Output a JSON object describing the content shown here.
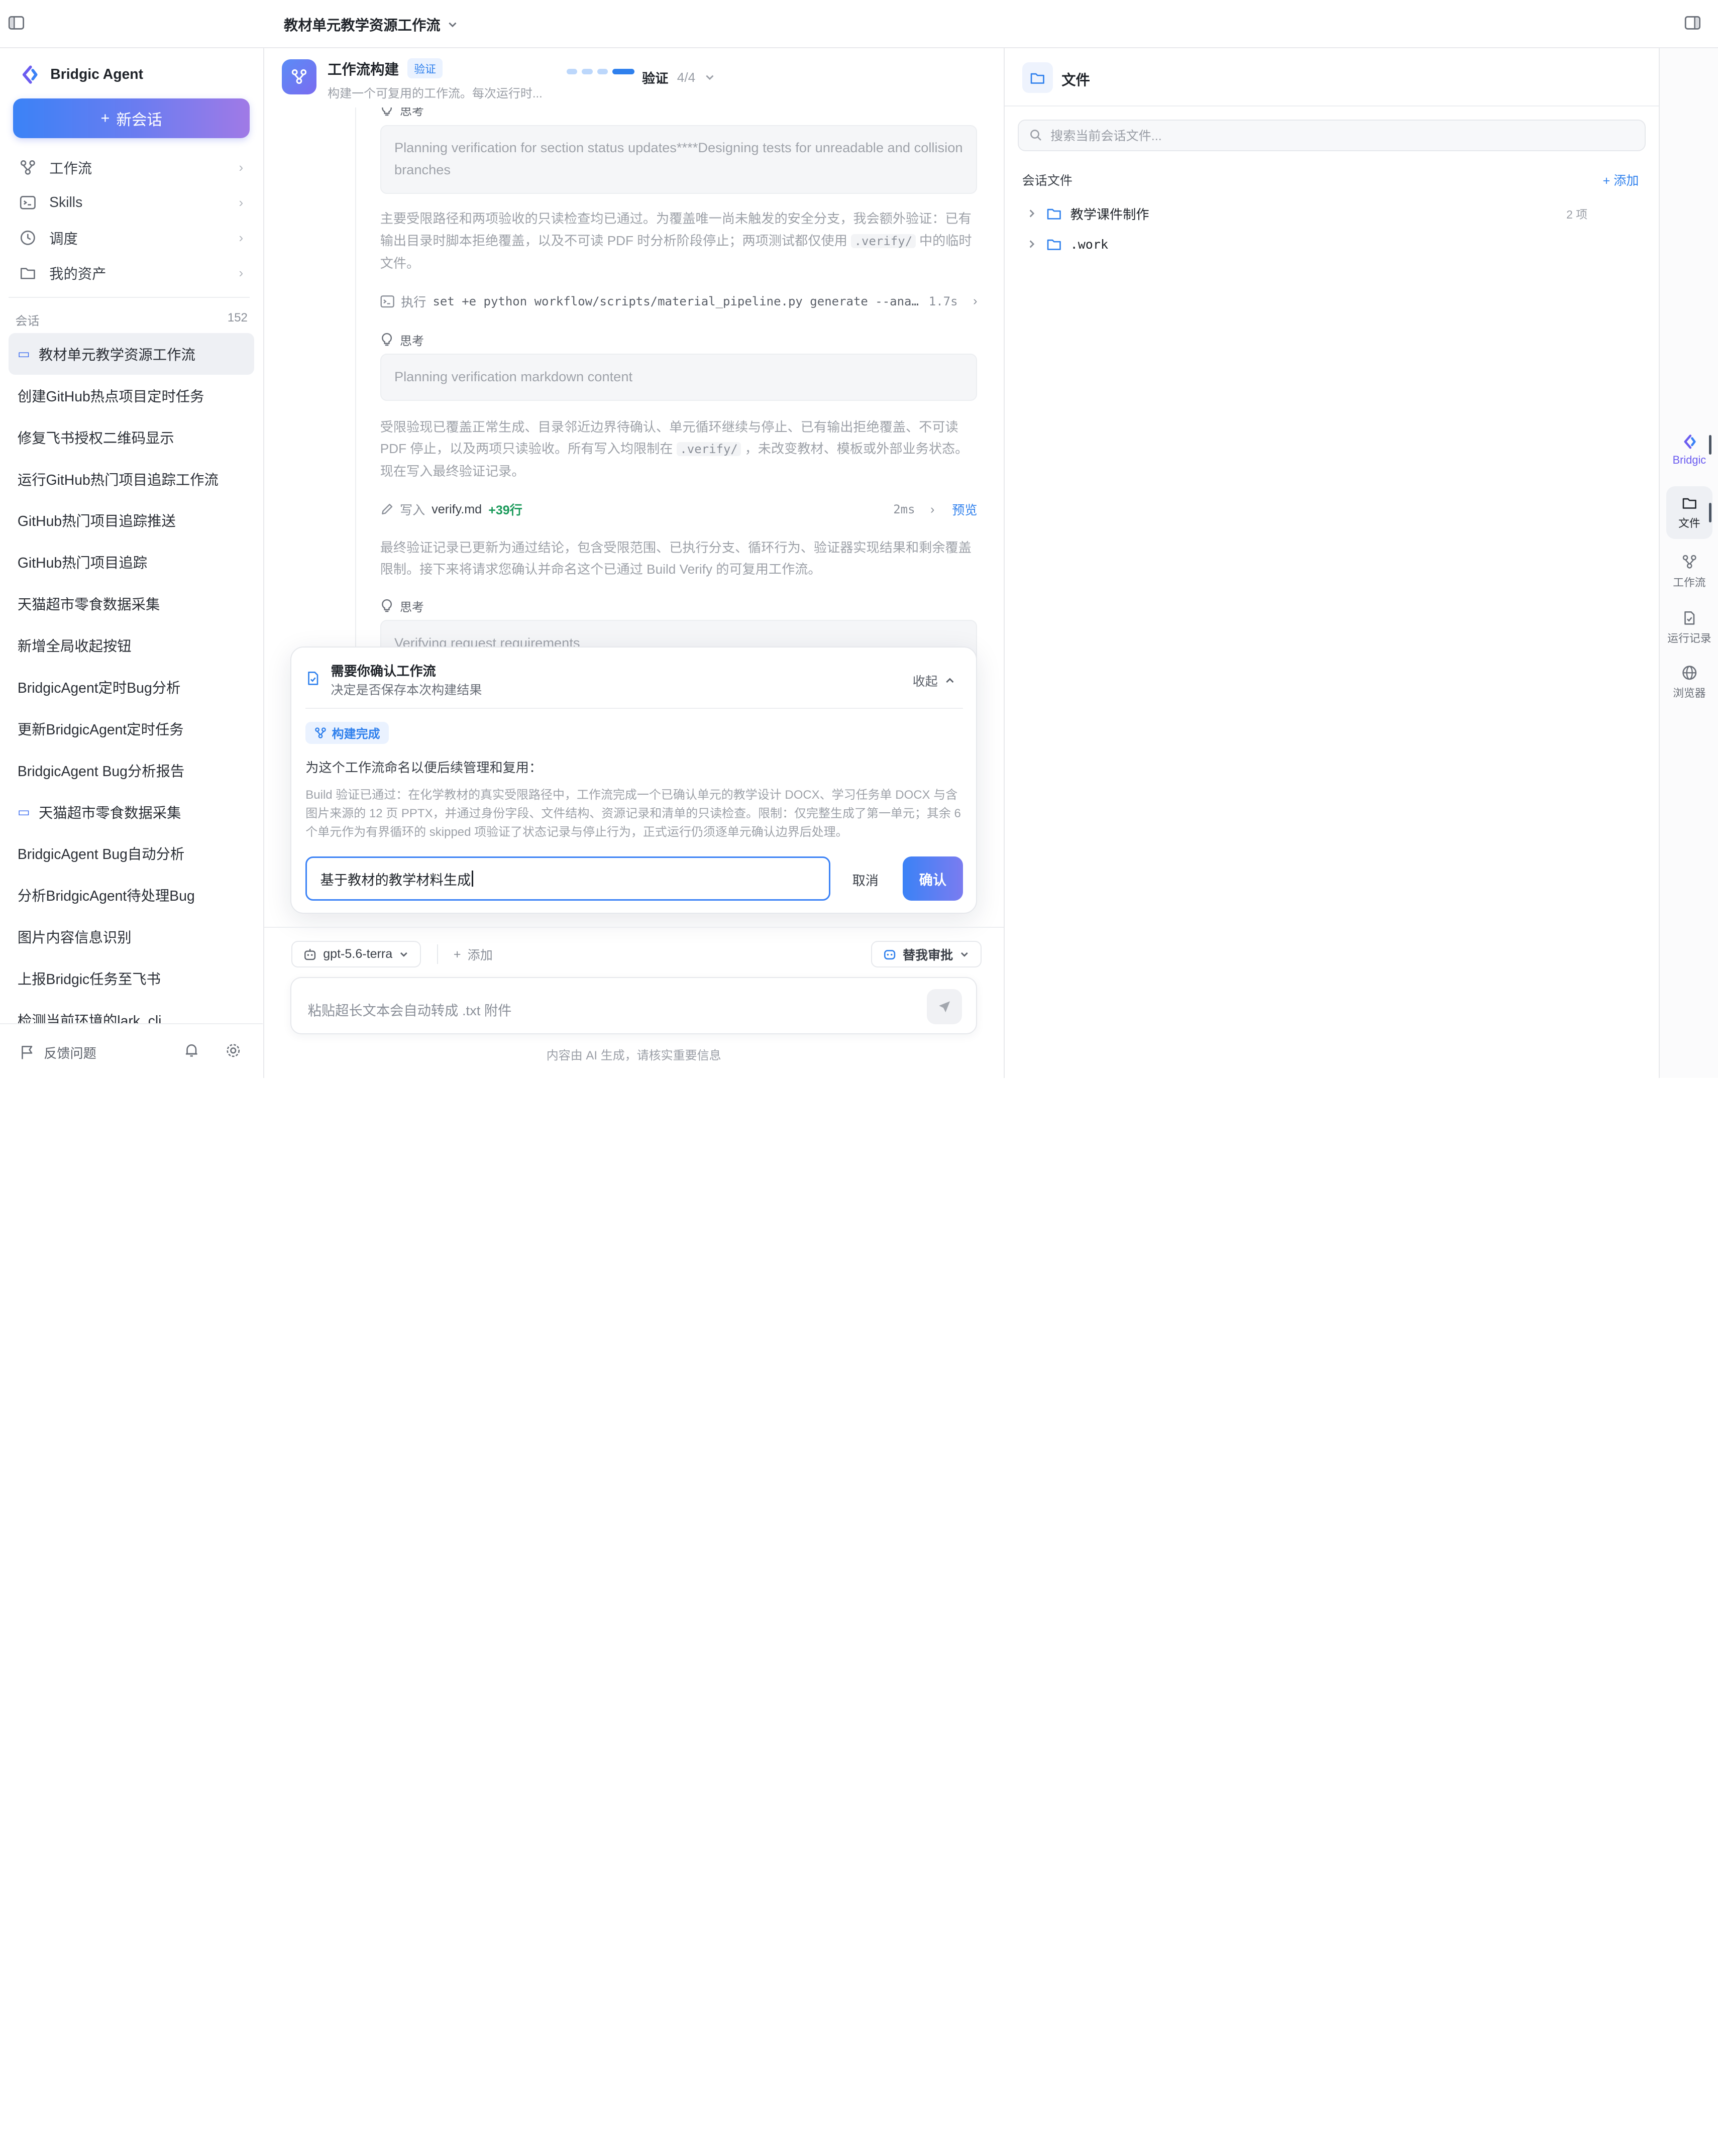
{
  "topbar": {
    "title": "教材单元教学资源工作流"
  },
  "sidebar": {
    "brand": "Bridgic Agent",
    "new_chat": "新会话",
    "nav": [
      {
        "label": "工作流",
        "icon": "workflow-icon"
      },
      {
        "label": "Skills",
        "icon": "terminal-icon"
      },
      {
        "label": "调度",
        "icon": "clock-icon"
      },
      {
        "label": "我的资产",
        "icon": "folder-icon"
      }
    ],
    "sessions_label": "会话",
    "sessions_count": "152",
    "sessions": [
      "教材单元教学资源工作流",
      "创建GitHub热点项目定时任务",
      "修复飞书授权二维码显示",
      "运行GitHub热门项目追踪工作流",
      "GitHub热门项目追踪推送",
      "GitHub热门项目追踪",
      "天猫超市零食数据采集",
      "新增全局收起按钮",
      "BridgicAgent定时Bug分析",
      "更新BridgicAgent定时任务",
      "BridgicAgent Bug分析报告",
      "天猫超市零食数据采集",
      "BridgicAgent Bug自动分析",
      "分析BridgicAgent待处理Bug",
      "图片内容信息识别",
      "上报Bridgic任务至飞书",
      "检测当前环境的lark_cli"
    ],
    "feedback": "反馈问题"
  },
  "workflow": {
    "title": "工作流构建",
    "badge": "验证",
    "subtitle": "构建一个可复用的工作流。每次运行时...",
    "step_label": "验证",
    "step_count": "4/4"
  },
  "stream": {
    "think_label": "思考",
    "think_1": "Planning verification for section status updates****Designing tests for unreadable and collision branches",
    "para_1_a": "主要受限路径和两项验收的只读检查均已通过。为覆盖唯一尚未触发的安全分支，我会额外验证：已有输出目录时脚本拒绝覆盖，以及不可读 PDF 时分析阶段停止；两项测试都仅使用",
    "para_1_code": ".verify/",
    "para_1_b": "中的临时文件。",
    "exec_label": "执行",
    "exec_cmd": "set +e python workflow/scripts/material_pipeline.py generate --ana…",
    "exec_dur": "1.7s",
    "think_2": "Planning verification markdown content",
    "para_2_a": "受限验现已覆盖正常生成、目录邻近边界待确认、单元循环继续与停止、已有输出拒绝覆盖、不可读 PDF 停止，以及两项只读验收。所有写入均限制在",
    "para_2_code": ".verify/",
    "para_2_b": "，未改变教材、模板或外部业务状态。现在写入最终验证记录。",
    "write_label": "写入",
    "write_file": "verify.md",
    "write_add": "+39行",
    "write_dur": "2ms",
    "write_preview": "预览",
    "para_3": "最终验证记录已更新为通过结论，包含受限范围、已执行分支、循环行为、验证器实现结果和剩余覆盖限制。接下来将请求您确认并命名这个已通过 Build Verify 的可复用工作流。",
    "think_3": "Verifying request requirements"
  },
  "confirm": {
    "title": "需要你确认工作流",
    "subtitle": "决定是否保存本次构建结果",
    "collapse": "收起",
    "badge": "构建完成",
    "question": "为这个工作流命名以便后续管理和复用：",
    "description": "Build 验证已通过：在化学教材的真实受限路径中，工作流完成一个已确认单元的教学设计 DOCX、学习任务单 DOCX 与含图片来源的 12 页 PPTX，并通过身份字段、文件结构、资源记录和清单的只读检查。限制：仅完整生成了第一单元；其余 6 个单元作为有界循环的 skipped 项验证了状态记录与停止行为，正式运行仍须逐单元确认边界后处理。",
    "input_value": "基于教材的教学材料生成",
    "cancel": "取消",
    "ok": "确认"
  },
  "composer": {
    "model": "gpt-5.6-terra",
    "add": "添加",
    "approve": "替我审批",
    "placeholder": "粘贴超长文本会自动转成 .txt 附件",
    "disclaimer": "内容由 AI 生成，请核实重要信息"
  },
  "files": {
    "title": "文件",
    "search_placeholder": "搜索当前会话文件...",
    "section": "会话文件",
    "add": "添加",
    "tree": [
      {
        "name": "教学课件制作",
        "count": "2 项"
      },
      {
        "name": ".work",
        "count": ""
      }
    ]
  },
  "rail": [
    {
      "label": "Bridgic",
      "icon": "bridgic-logo-icon"
    },
    {
      "label": "文件",
      "icon": "folder-icon"
    },
    {
      "label": "工作流",
      "icon": "workflow-icon"
    },
    {
      "label": "运行记录",
      "icon": "file-check-icon"
    },
    {
      "label": "浏览器",
      "icon": "globe-icon"
    }
  ],
  "colors": {
    "accent": "#2f80ed",
    "gradient_start": "#3b82f6",
    "gradient_end": "#a07ae6",
    "success": "#1a9a5a"
  }
}
